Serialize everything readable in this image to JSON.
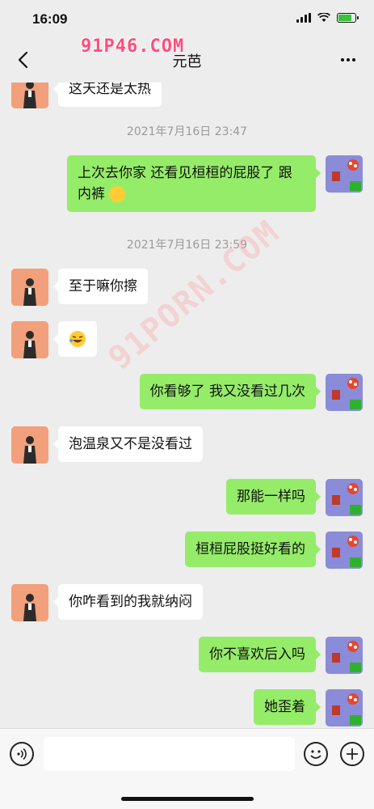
{
  "status_bar": {
    "time": "16:09",
    "battery_level": 0.8,
    "battery_color": "#3cc13c"
  },
  "nav": {
    "title": "元芭",
    "watermark": "91P46.COM"
  },
  "overlay_watermark": "91PORN.COM",
  "messages": [
    {
      "side": "left",
      "text": "这天还是太热"
    },
    {
      "side": "time",
      "text": "2021年7月16日 23:47"
    },
    {
      "side": "right",
      "text": "上次去你家 还看见桓桓的屁股了 跟内裤",
      "emoji": "wink-emoji"
    },
    {
      "side": "time",
      "text": "2021年7月16日 23:59"
    },
    {
      "side": "left",
      "text": "至于嘛你擦"
    },
    {
      "side": "left",
      "text": "",
      "emoji": "laughing-crying-emoji"
    },
    {
      "side": "right",
      "text": "你看够了 我又没看过几次"
    },
    {
      "side": "left",
      "text": "泡温泉又不是没看过"
    },
    {
      "side": "right",
      "text": "那能一样吗"
    },
    {
      "side": "right",
      "text": "桓桓屁股挺好看的"
    },
    {
      "side": "left",
      "text": "你咋看到的我就纳闷"
    },
    {
      "side": "right",
      "text": "你不喜欢后入吗"
    },
    {
      "side": "right",
      "text": "她歪着"
    }
  ],
  "input_bar": {
    "placeholder": ""
  },
  "colors": {
    "bubble_sent": "#95ec69",
    "bubble_received": "#ffffff",
    "background": "#ededed"
  }
}
